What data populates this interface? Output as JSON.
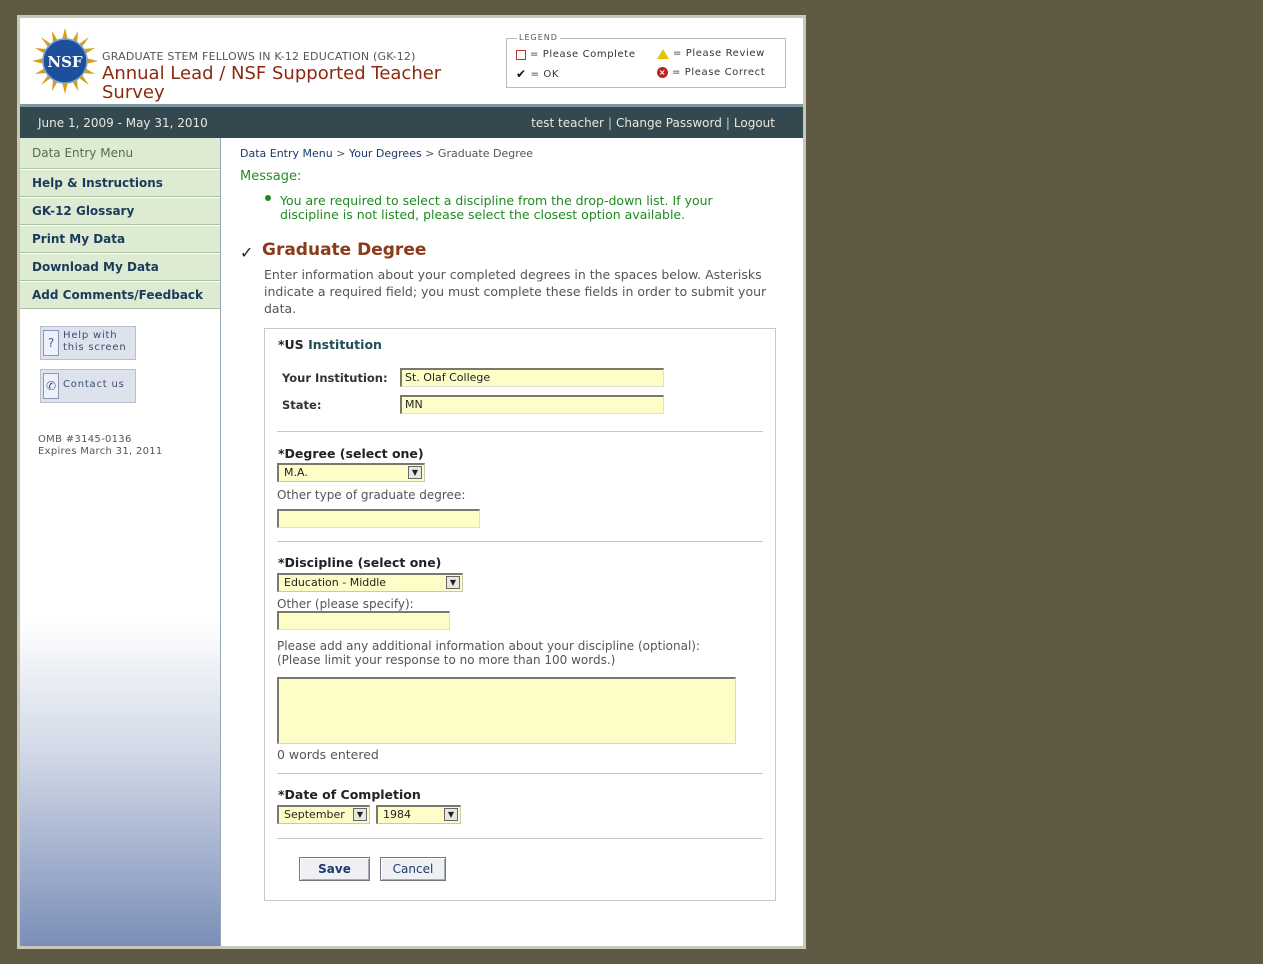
{
  "header": {
    "logo_text": "NSF",
    "org": "GRADUATE STEM FELLOWS IN K-12 EDUCATION (GK-12)",
    "title": "Annual Lead / NSF Supported Teacher Survey",
    "legend": {
      "title": "LEGEND",
      "please_complete": "= Please Complete",
      "please_review": "= Please Review",
      "ok": "= OK",
      "please_correct": "= Please Correct"
    }
  },
  "datebar": {
    "dates": "June 1, 2009 - May 31, 2010",
    "user": "test teacher",
    "change_password": "Change Password",
    "logout": "Logout",
    "separator": "|"
  },
  "sidebar": {
    "heading": "Data Entry Menu",
    "items": [
      {
        "label": "Help & Instructions"
      },
      {
        "label": "GK-12 Glossary"
      },
      {
        "label": "Print My Data"
      },
      {
        "label": "Download My Data"
      },
      {
        "label": "Add Comments/Feedback"
      }
    ],
    "help_button": {
      "line1": "Help with",
      "line2": "this screen"
    },
    "contact_button": {
      "label": "Contact us"
    },
    "omb": {
      "line1": "OMB #3145-0136",
      "line2": "Expires March 31, 2011"
    }
  },
  "content": {
    "breadcrumb": {
      "item1": "Data Entry Menu",
      "item2": "Your Degrees",
      "current": "Graduate Degree",
      "sep": ">"
    },
    "message_label": "Message:",
    "message_text": "You are required to select a discipline from the drop-down list. If your discipline is not listed, please select the closest option available.",
    "check": "✓",
    "section_title": "Graduate Degree",
    "intro": "Enter information about your completed degrees in the spaces below. Asterisks indicate a required field; you must complete these fields in order to submit your data.",
    "institution": {
      "title_prefix": "*US",
      "title_suffix": "Institution",
      "institution_label": "Your Institution:",
      "institution_value": "St. Olaf College",
      "state_label": "State:",
      "state_value": "MN"
    },
    "degree": {
      "title": "*Degree (select one)",
      "selected": "M.A.",
      "other_label": "Other type of graduate degree:",
      "other_value": ""
    },
    "discipline": {
      "title": "*Discipline (select one)",
      "selected": "Education - Middle",
      "other_label": "Other (please specify):",
      "other_value": "",
      "additional_label": "Please add any additional information about your discipline (optional):",
      "limit_label": "(Please limit your response to no more than 100 words.)",
      "word_count": "0 words entered"
    },
    "completion": {
      "title": "*Date of Completion",
      "month": "September",
      "year": "1984"
    },
    "buttons": {
      "save": "Save",
      "cancel": "Cancel"
    }
  },
  "colors": {
    "background": "#5e5a43",
    "title": "#8b2a10",
    "datebar": "#34494f",
    "menu": "#dcebd1",
    "message": "#1f8a1f",
    "input": "#fdfdc8"
  },
  "icons": [
    "nsf-logo",
    "checkbox-empty-icon",
    "warning-icon",
    "check-icon",
    "error-icon",
    "question-icon",
    "phone-icon",
    "dropdown-arrow-icon"
  ]
}
